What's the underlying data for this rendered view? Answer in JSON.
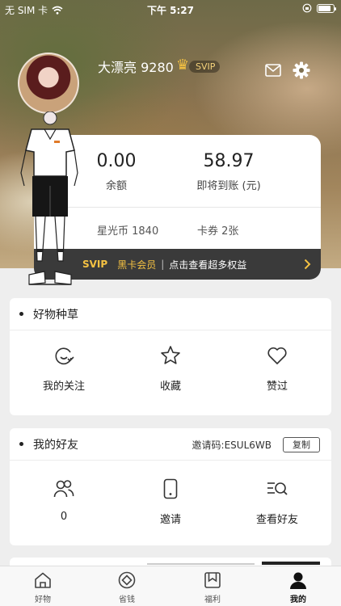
{
  "status_bar": {
    "carrier": "无 SIM 卡",
    "time": "下午 5:27",
    "battery_level": 0.85
  },
  "profile": {
    "username": "大漂亮 9280",
    "badge": "SVIP"
  },
  "wallet": {
    "balance_value": "0.00",
    "balance_label": "余额",
    "pending_value": "58.97",
    "pending_label": "即将到账 (元)",
    "stars": "星光币 1840",
    "coupons": "卡券 2张",
    "svip_bar": {
      "svip": "SVIP",
      "member": "黑卡会员",
      "separator": "|",
      "text": "点击查看超多权益"
    }
  },
  "good_things": {
    "title": "好物种草",
    "items": [
      {
        "label": "我的关注",
        "icon": "follow-icon"
      },
      {
        "label": "收藏",
        "icon": "star-icon"
      },
      {
        "label": "赞过",
        "icon": "heart-icon"
      }
    ]
  },
  "friends": {
    "title": "我的好友",
    "invite_code": "邀请码:ESUL6WB",
    "copy_label": "复制",
    "items": [
      {
        "label": "0",
        "icon": "friends-icon"
      },
      {
        "label": "邀请",
        "icon": "invite-phone-icon"
      },
      {
        "label": "查看好友",
        "icon": "search-list-icon"
      }
    ]
  },
  "tabbar": {
    "tabs": [
      {
        "label": "好物",
        "icon": "home-icon",
        "active": false
      },
      {
        "label": "省钱",
        "icon": "coin-icon",
        "active": false
      },
      {
        "label": "福利",
        "icon": "bookmark-icon",
        "active": false
      },
      {
        "label": "我的",
        "icon": "user-icon",
        "active": true
      }
    ]
  },
  "colors": {
    "accent_gold": "#f5c242",
    "svip_bar_bg": "#3a3a3a",
    "page_bg": "#eeeeee"
  }
}
